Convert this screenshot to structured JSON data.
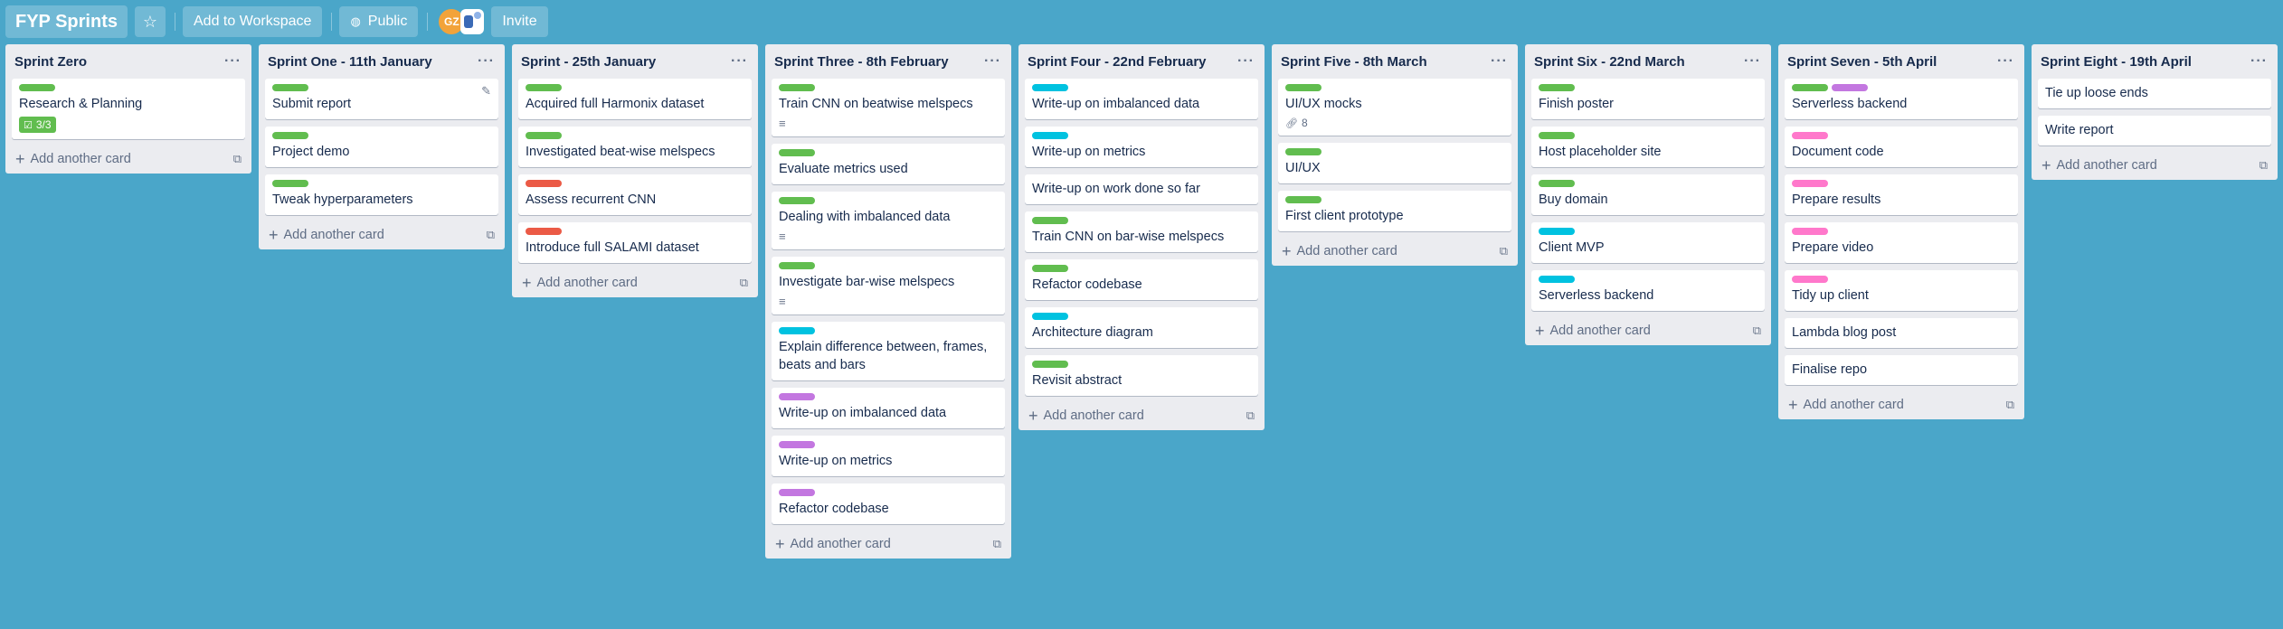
{
  "colors": {
    "green": "#61bd4f",
    "blue": "#00c2e0",
    "red": "#eb5a46",
    "purple": "#c377e0",
    "pink": "#ff78cb",
    "background": "#4aa6c9"
  },
  "header": {
    "board_title": "FYP Sprints",
    "star_icon": "star-icon",
    "add_to_workspace": "Add to Workspace",
    "visibility": "Public",
    "avatar_initials": "GZ",
    "invite": "Invite"
  },
  "add_card_label": "Add another card",
  "lists": [
    {
      "title": "Sprint Zero",
      "cards": [
        {
          "title": "Research & Planning",
          "labels": [
            "green"
          ],
          "checklist": "3/3"
        }
      ]
    },
    {
      "title": "Sprint One - 11th January",
      "cards": [
        {
          "title": "Submit report",
          "labels": [
            "green"
          ],
          "hover_edit": true
        },
        {
          "title": "Project demo",
          "labels": [
            "green"
          ]
        },
        {
          "title": "Tweak hyperparameters",
          "labels": [
            "green"
          ]
        }
      ]
    },
    {
      "title": "Sprint - 25th January",
      "cards": [
        {
          "title": "Acquired full Harmonix dataset",
          "labels": [
            "green"
          ]
        },
        {
          "title": "Investigated beat-wise melspecs",
          "labels": [
            "green"
          ]
        },
        {
          "title": "Assess recurrent CNN",
          "labels": [
            "red"
          ]
        },
        {
          "title": "Introduce full SALAMI dataset",
          "labels": [
            "red"
          ]
        }
      ]
    },
    {
      "title": "Sprint Three - 8th February",
      "cards": [
        {
          "title": "Train CNN on beatwise melspecs",
          "labels": [
            "green"
          ],
          "description": true
        },
        {
          "title": "Evaluate metrics used",
          "labels": [
            "green"
          ]
        },
        {
          "title": "Dealing with imbalanced data",
          "labels": [
            "green"
          ],
          "description": true
        },
        {
          "title": "Investigate bar-wise melspecs",
          "labels": [
            "green"
          ],
          "description": true
        },
        {
          "title": "Explain difference between, frames, beats and bars",
          "labels": [
            "blue"
          ]
        },
        {
          "title": "Write-up on imbalanced data",
          "labels": [
            "purple"
          ]
        },
        {
          "title": "Write-up on metrics",
          "labels": [
            "purple"
          ]
        },
        {
          "title": "Refactor codebase",
          "labels": [
            "purple"
          ]
        }
      ]
    },
    {
      "title": "Sprint Four - 22nd February",
      "cards": [
        {
          "title": "Write-up on imbalanced data",
          "labels": [
            "blue"
          ]
        },
        {
          "title": "Write-up on metrics",
          "labels": [
            "blue"
          ]
        },
        {
          "title": "Write-up on work done so far",
          "labels": []
        },
        {
          "title": "Train CNN on bar-wise melspecs",
          "labels": [
            "green"
          ]
        },
        {
          "title": "Refactor codebase",
          "labels": [
            "green"
          ]
        },
        {
          "title": "Architecture diagram",
          "labels": [
            "blue"
          ]
        },
        {
          "title": "Revisit abstract",
          "labels": [
            "green"
          ]
        }
      ]
    },
    {
      "title": "Sprint Five - 8th March",
      "cards": [
        {
          "title": "UI/UX mocks",
          "labels": [
            "green"
          ],
          "attachments": "8"
        },
        {
          "title": "UI/UX",
          "labels": [
            "green"
          ]
        },
        {
          "title": "First client prototype",
          "labels": [
            "green"
          ]
        }
      ]
    },
    {
      "title": "Sprint Six - 22nd March",
      "cards": [
        {
          "title": "Finish poster",
          "labels": [
            "green"
          ]
        },
        {
          "title": "Host placeholder site",
          "labels": [
            "green"
          ]
        },
        {
          "title": "Buy domain",
          "labels": [
            "green"
          ]
        },
        {
          "title": "Client MVP",
          "labels": [
            "blue"
          ]
        },
        {
          "title": "Serverless backend",
          "labels": [
            "blue"
          ]
        }
      ]
    },
    {
      "title": "Sprint Seven - 5th April",
      "cards": [
        {
          "title": "Serverless backend",
          "labels": [
            "green",
            "purple"
          ]
        },
        {
          "title": "Document code",
          "labels": [
            "pink"
          ]
        },
        {
          "title": "Prepare results",
          "labels": [
            "pink"
          ]
        },
        {
          "title": "Prepare video",
          "labels": [
            "pink"
          ]
        },
        {
          "title": "Tidy up client",
          "labels": [
            "pink"
          ]
        },
        {
          "title": "Lambda blog post",
          "labels": []
        },
        {
          "title": "Finalise repo",
          "labels": []
        }
      ]
    },
    {
      "title": "Sprint Eight - 19th April",
      "cards": [
        {
          "title": "Tie up loose ends",
          "labels": []
        },
        {
          "title": "Write report",
          "labels": []
        }
      ]
    }
  ]
}
